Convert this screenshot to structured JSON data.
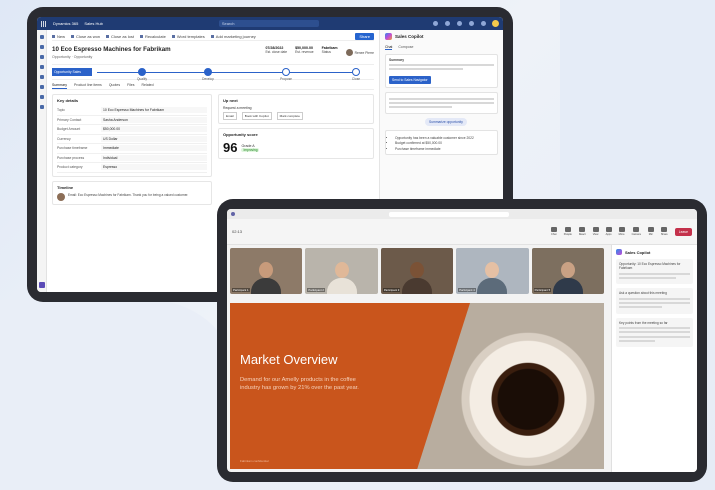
{
  "dynamics": {
    "brand": "Dynamics 365",
    "app": "Sales Hub",
    "search_placeholder": "Search",
    "commands": [
      "New",
      "Close as won",
      "Close as lost",
      "Recalculate",
      "Word templates",
      "Add marketing journey"
    ],
    "share_label": "Share",
    "record_title": "10 Eco Espresso Machines for Fabrikam",
    "record_subtitle": "Opportunity · Opportunity",
    "meta": [
      {
        "label": "Est. close date",
        "value": "07/28/2022"
      },
      {
        "label": "Est. revenue",
        "value": "$50,000.00"
      },
      {
        "label": "Status",
        "value": "Fabrikam"
      }
    ],
    "owner": "Renee Pierre",
    "bpf_active": "Opportunity Sales",
    "stages": [
      "Qualify",
      "Develop",
      "Propose",
      "Close"
    ],
    "tabs": [
      "Summary",
      "Product line items",
      "Quotes",
      "Files",
      "Related"
    ],
    "key_details_title": "Key details",
    "key_details": [
      {
        "k": "Topic",
        "v": "10 Eco Espresso Machines for Fabrikam"
      },
      {
        "k": "Primary Contact",
        "v": "Sasha Anderson"
      },
      {
        "k": "Budget Amount",
        "v": "$50,000.00"
      },
      {
        "k": "Currency",
        "v": "US Dollar"
      },
      {
        "k": "Purchase timeframe",
        "v": "Immediate"
      },
      {
        "k": "Purchase process",
        "v": "Individual"
      },
      {
        "k": "Product category",
        "v": "Espresso"
      }
    ],
    "up_next_title": "Up next",
    "up_next_item": "Request a meeting",
    "up_next_buttons": [
      "Email",
      "Book with Copilot",
      "Mark complete"
    ],
    "score_title": "Opportunity score",
    "score_value": "96",
    "score_grade": "Grade A",
    "score_trend": "Improving",
    "timeline_title": "Timeline",
    "timeline_entry": "Email: Eco Espresso Machines for Fabrikam. Thank you for being a valued customer.",
    "copilot_title": "Sales Copilot",
    "copilot_tabs": [
      "Chat",
      "Compose"
    ],
    "copilot_summary_heading": "Summary",
    "copilot_button": "Send to Sales Navigator",
    "copilot_pill": "Summarize opportunity",
    "copilot_bullets": [
      "Opportunity has been a valuable customer since 2022",
      "Budget confirmed at $50,000.00",
      "Purchase timeframe immediate"
    ]
  },
  "teams": {
    "time": "02:13",
    "controls": [
      "Chat",
      "People",
      "React",
      "View",
      "Apps",
      "More",
      "Camera",
      "Mic",
      "Share"
    ],
    "leave_label": "Leave",
    "tiles": [
      {
        "name": "Participant 1",
        "bg": "#8d7a68",
        "skin": "#c89b7b",
        "shirt": "#3b3b3b"
      },
      {
        "name": "Participant 2",
        "bg": "#b9b4ab",
        "skin": "#e0b898",
        "shirt": "#e8e2d8"
      },
      {
        "name": "Participant 3",
        "bg": "#6c5a4a",
        "skin": "#7b5236",
        "shirt": "#4a3a30"
      },
      {
        "name": "Participant 4",
        "bg": "#aeb6bf",
        "skin": "#e5c0a4",
        "shirt": "#5c6b7a"
      },
      {
        "name": "Participant 5",
        "bg": "#7d6f5f",
        "skin": "#c9a184",
        "shirt": "#2f3a4a"
      }
    ],
    "slide_title": "Market Overview",
    "slide_body": "Demand for our Amelly products in the coffee industry has grown by 21% over the past year.",
    "slide_footer": "Fabrikam confidential",
    "panel_title": "Sales Copilot",
    "panel_cards": [
      "Opportunity: 10 Eco Espresso Machines for Fabrikam",
      "Ask a question about this meeting",
      "Key points from the meeting so far"
    ]
  },
  "colors": {
    "dynamics_nav": "#1f3b73",
    "accent_blue": "#2b62c9",
    "slide_orange": "#c9551c",
    "leave_red": "#c4314b"
  }
}
